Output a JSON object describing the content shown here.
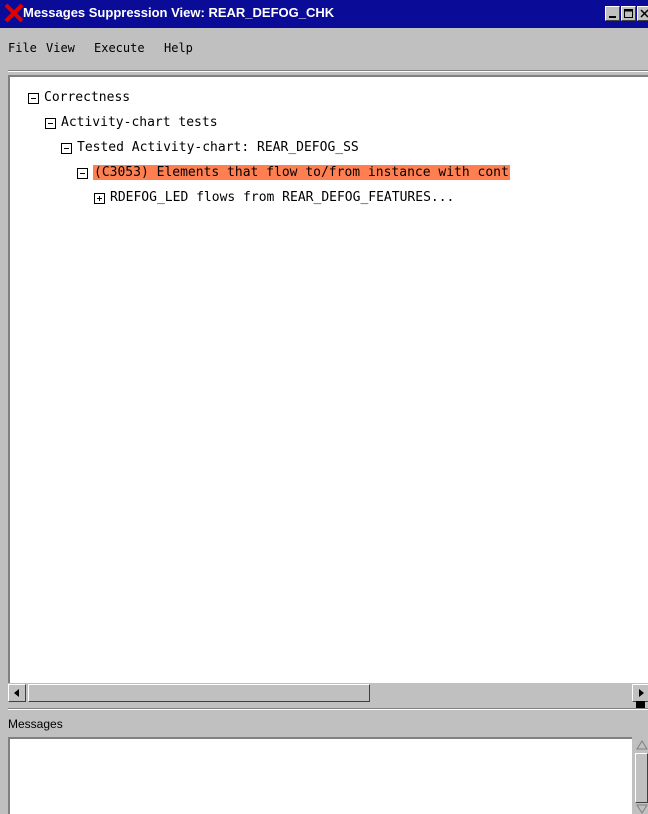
{
  "window": {
    "title": "Messages Suppression View: REAR_DEFOG_CHK",
    "icon": "x-logo-icon"
  },
  "menu": [
    "File",
    "View",
    "Execute",
    "Help"
  ],
  "tree": [
    {
      "label": "Correctness",
      "state": "expanded",
      "level": 0
    },
    {
      "label": "Activity-chart tests",
      "state": "expanded",
      "level": 1
    },
    {
      "label": "Tested Activity-chart:  REAR_DEFOG_SS",
      "state": "expanded",
      "level": 2
    },
    {
      "label": "(C3053)  Elements that flow to/from instance with cont",
      "state": "expanded",
      "level": 3,
      "selected": true
    },
    {
      "label": "RDEFOG_LED flows from REAR_DEFOG_FEATURES...",
      "state": "collapsed",
      "level": 4
    }
  ],
  "messages": {
    "label": "Messages"
  },
  "colors": {
    "titlebar": "#0a0c98",
    "selection": "#ff7f50",
    "chrome": "#c0c0c0"
  }
}
